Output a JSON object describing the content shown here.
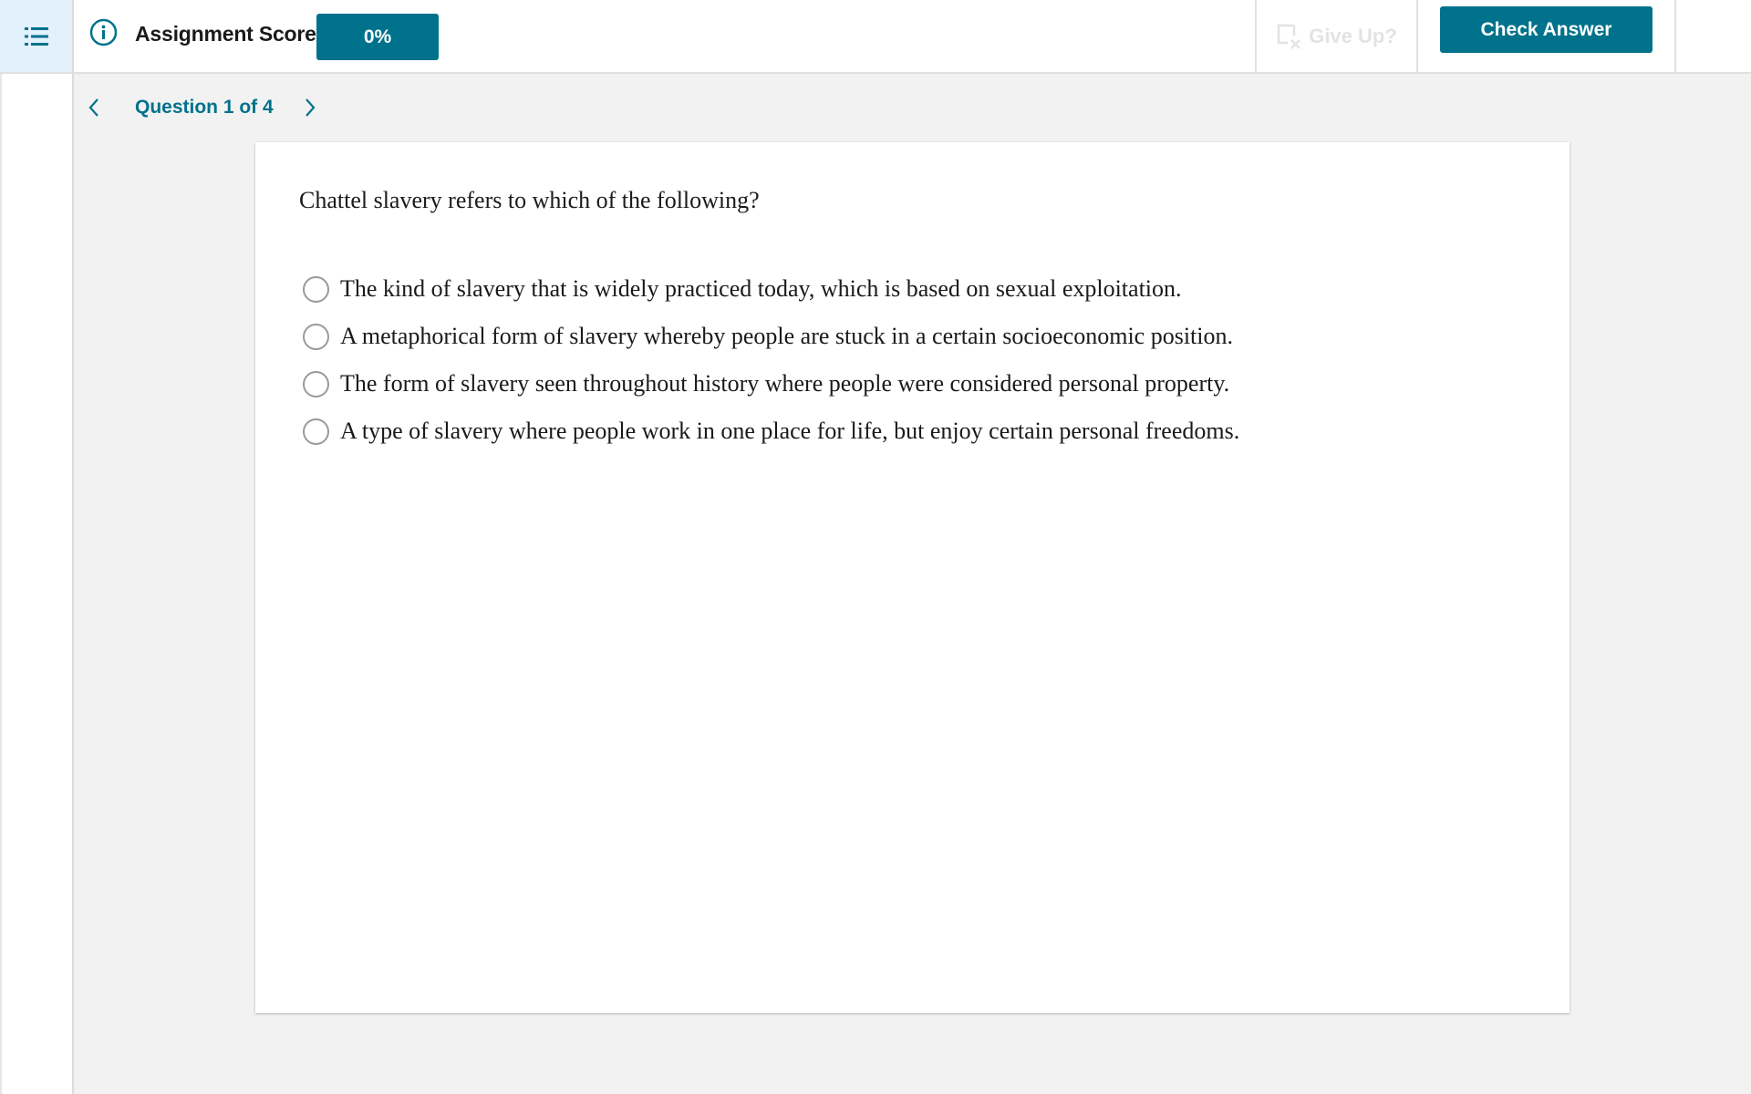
{
  "header": {
    "menu_icon": "list-icon",
    "info_icon": "info-circle-icon",
    "score_label": "Assignment Score:",
    "score_value": "0%",
    "give_up_label": "Give Up?",
    "give_up_icon": "give-up-icon",
    "check_answer_label": "Check Answer"
  },
  "navigation": {
    "prev_icon": "chevron-left-icon",
    "next_icon": "chevron-right-icon",
    "question_label": "Question 1 of 4"
  },
  "question": {
    "prompt": "Chattel slavery refers to which of the following?",
    "options": [
      {
        "label": "The kind of slavery that is widely practiced today, which is based on sexual exploitation.",
        "selected": false
      },
      {
        "label": "A metaphorical form of slavery whereby people are stuck in a certain socioeconomic position.",
        "selected": false
      },
      {
        "label": "The form of slavery seen throughout history where people were considered personal property.",
        "selected": false
      },
      {
        "label": "A type of slavery where people work in one place for life, but enjoy certain personal freedoms.",
        "selected": false
      }
    ]
  },
  "colors": {
    "accent": "#00728b",
    "menu_active_bg": "#e3f1fc",
    "page_bg": "#f2f2f2",
    "disabled_text": "#e3e3e3"
  }
}
